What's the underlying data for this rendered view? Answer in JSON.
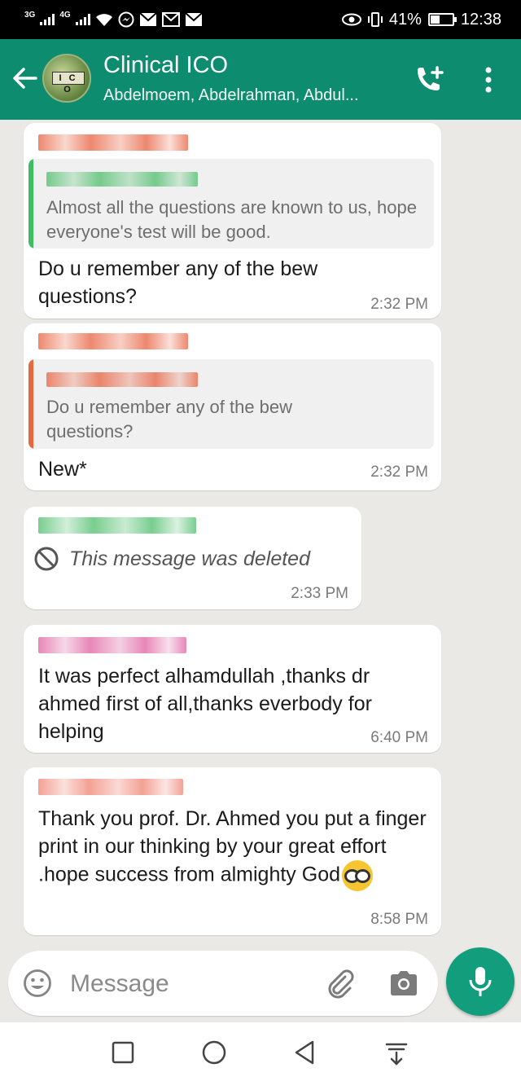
{
  "status_bar": {
    "network_1": "3G",
    "network_2": "4G",
    "battery_percent": "41%",
    "battery_level": 0.41,
    "time": "12:38"
  },
  "header": {
    "title": "Clinical ICO",
    "subtitle": "Abdelmoem, Abdelrahman, Abdul...",
    "avatar_text": "I C O"
  },
  "messages": [
    {
      "sender_color": "#e96a4a",
      "quote_name_color": "#56c173",
      "quote_bar_color": "#3dbf5f",
      "quote_text": "Almost all the questions are known to us, hope everyone's test will be good.",
      "text": "Do u remember any of the bew questions?",
      "time": "2:32 PM"
    },
    {
      "sender_color": "#e96a4a",
      "quote_name_color": "#e96a4a",
      "quote_bar_color": "#e8673b",
      "quote_text": "Do u remember any of the bew questions?",
      "text": "New*",
      "time": "2:32 PM"
    },
    {
      "sender_color": "#56c173",
      "text": "This message was deleted",
      "time": "2:33 PM"
    },
    {
      "sender_color": "#e06aa6",
      "text": "It was perfect alhamdullah ,thanks dr ahmed first of all,thanks everbody for helping",
      "time": "6:40 PM"
    },
    {
      "sender_color": "#f08a7a",
      "text": "Thank you prof. Dr. Ahmed you put a finger print in our thinking by your great effort .hope success from almighty  God",
      "time": "8:58 PM"
    }
  ],
  "input": {
    "placeholder": "Message"
  },
  "colors": {
    "header": "#0e8c70",
    "mic_button": "#129e7c",
    "chat_background": "#eae9e5"
  }
}
